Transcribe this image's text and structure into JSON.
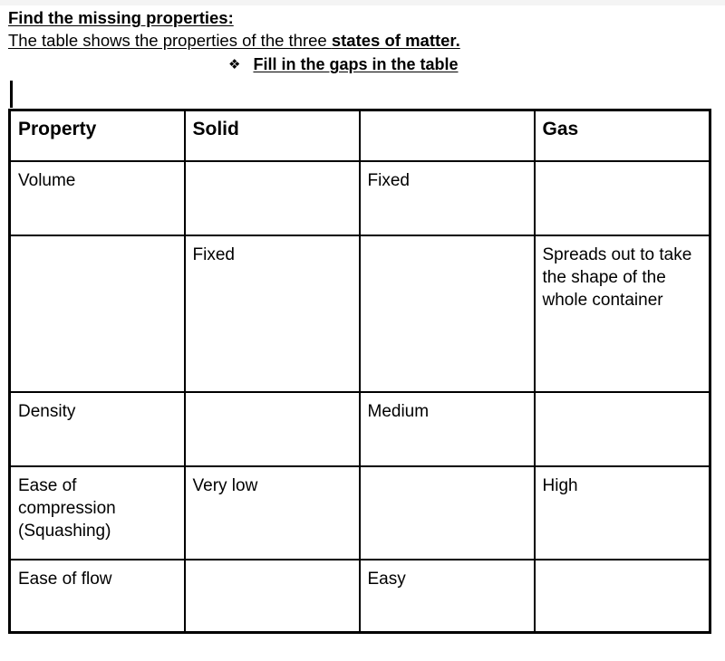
{
  "document": {
    "title_line": "Find the missing properties:",
    "intro_line": {
      "normal_text": "The table shows the properties of the three ",
      "bold_text": "states of matter."
    },
    "instruction": {
      "bullet_icon": "diamond-bullet-icon",
      "bullet_glyph": "❖",
      "text": "Fill in the gaps in the table"
    },
    "caret": {
      "icon": "text-caret"
    }
  },
  "table": {
    "headers": [
      "Property",
      "Solid",
      "",
      "Gas"
    ],
    "rows": [
      {
        "name": "volume-row",
        "cells": [
          "Volume",
          "",
          "Fixed",
          ""
        ]
      },
      {
        "name": "shape-row",
        "cells": [
          "",
          "Fixed",
          "",
          "Spreads out to take the shape of the whole container"
        ]
      },
      {
        "name": "density-row",
        "cells": [
          "Density",
          "",
          "Medium",
          ""
        ]
      },
      {
        "name": "compression-row",
        "cells": [
          "Ease of compression (Squashing)",
          "Very low",
          "",
          "High"
        ]
      },
      {
        "name": "flow-row",
        "cells": [
          "Ease of flow",
          "",
          "Easy",
          ""
        ]
      }
    ]
  },
  "colors": {
    "text": "#000000",
    "background": "#ffffff",
    "border": "#000000",
    "top_strip": "#f4f4f4"
  }
}
